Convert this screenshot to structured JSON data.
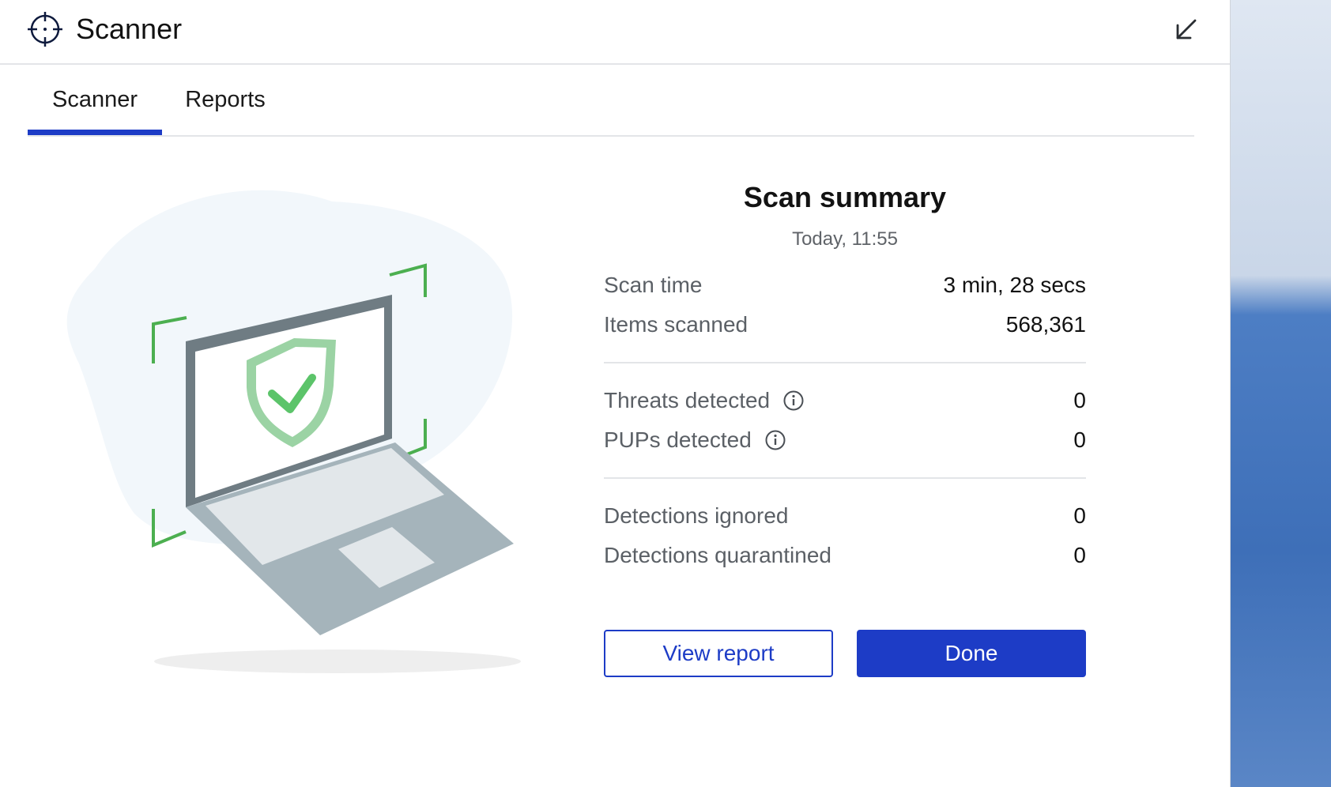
{
  "header": {
    "title": "Scanner",
    "app_icon": "crosshair-icon",
    "collapse_icon": "arrow-down-left-icon"
  },
  "tabs": [
    {
      "label": "Scanner",
      "active": true
    },
    {
      "label": "Reports",
      "active": false
    }
  ],
  "summary": {
    "title": "Scan summary",
    "date": "Today, 11:55",
    "rows": [
      {
        "label": "Scan time",
        "value": "3 min, 28 secs"
      },
      {
        "label": "Items scanned",
        "value": "568,361"
      },
      {
        "label": "Threats detected",
        "value": "0"
      },
      {
        "label": "PUPs detected",
        "value": "0"
      },
      {
        "label": "Detections ignored",
        "value": "0"
      },
      {
        "label": "Detections quarantined",
        "value": "0"
      }
    ]
  },
  "actions": {
    "view_report": "View report",
    "done": "Done"
  },
  "colors": {
    "accent": "#1d3cc6",
    "success": "#5cc46a",
    "frame": "#4caf50"
  }
}
